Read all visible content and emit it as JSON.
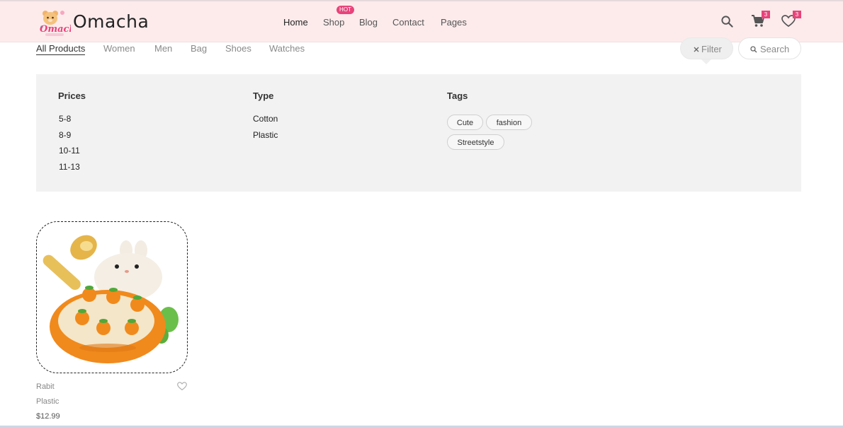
{
  "header": {
    "brand": "Omacha",
    "logo_text": "Omacha",
    "nav": [
      {
        "label": "Home"
      },
      {
        "label": "Shop"
      },
      {
        "label": "Blog"
      },
      {
        "label": "Contact"
      },
      {
        "label": "Pages"
      }
    ],
    "hot_badge": "HOT",
    "cart_count": "3",
    "wishlist_count": "3",
    "icons": [
      "search-icon",
      "cart-icon",
      "heart-icon"
    ]
  },
  "categories": {
    "tabs": [
      "All Products",
      "Women",
      "Men",
      "Bag",
      "Shoes",
      "Watches"
    ],
    "active": "All Products"
  },
  "controls": {
    "filter_label": "Filter",
    "search_label": "Search"
  },
  "filters": {
    "prices": {
      "title": "Prices",
      "options": [
        "5-8",
        "8-9",
        "10-11",
        "11-13"
      ]
    },
    "type": {
      "title": "Type",
      "options": [
        "Cotton",
        "Plastic"
      ]
    },
    "tags": {
      "title": "Tags",
      "options": [
        "Cute",
        "fashion",
        "Streetstyle"
      ]
    }
  },
  "products": [
    {
      "name": "Rabit",
      "type": "Plastic",
      "price": "$12.99"
    }
  ],
  "colors": {
    "header_bg": "#fdebec",
    "badge": "#e8437a",
    "panel_bg": "#f2f2f2"
  }
}
